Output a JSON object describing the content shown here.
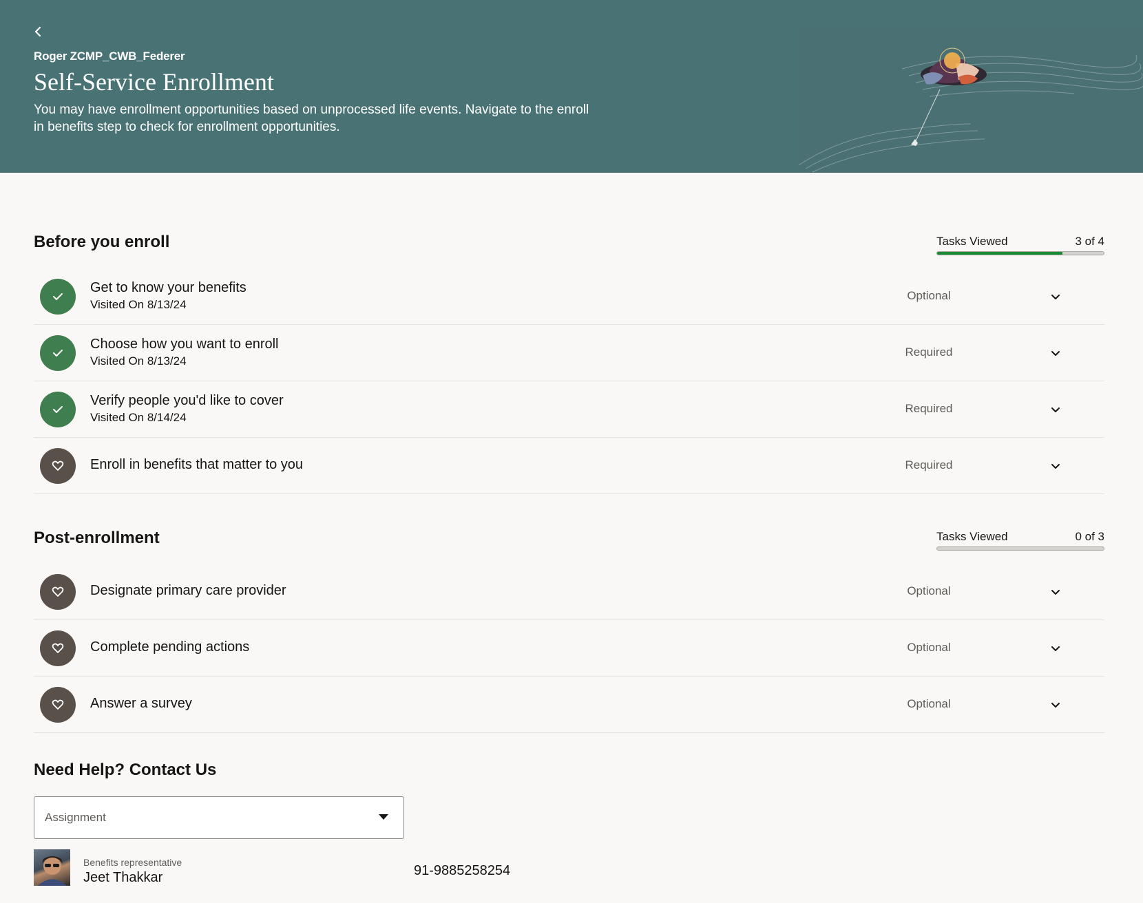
{
  "header": {
    "user_name": "Roger ZCMP_CWB_Federer",
    "title": "Self-Service Enrollment",
    "description": "You may have enrollment opportunities based on unprocessed life events. Navigate to the enroll in benefits step to check for enrollment opportunities."
  },
  "before_enroll": {
    "title": "Before you enroll",
    "progress_label": "Tasks Viewed",
    "progress_count": "3 of 4",
    "progress_fraction": 0.75,
    "tasks": [
      {
        "name": "Get to know your benefits",
        "visited": "Visited On 8/13/24",
        "status": "Optional",
        "done": true
      },
      {
        "name": "Choose how you want to enroll",
        "visited": "Visited On 8/13/24",
        "status": "Required",
        "done": true
      },
      {
        "name": "Verify people you'd like to cover",
        "visited": "Visited On 8/14/24",
        "status": "Required",
        "done": true
      },
      {
        "name": "Enroll in benefits that matter to you",
        "visited": "",
        "status": "Required",
        "done": false
      }
    ]
  },
  "post_enroll": {
    "title": "Post-enrollment",
    "progress_label": "Tasks Viewed",
    "progress_count": "0 of 3",
    "progress_fraction": 0,
    "tasks": [
      {
        "name": "Designate primary care provider",
        "visited": "",
        "status": "Optional",
        "done": false
      },
      {
        "name": "Complete pending actions",
        "visited": "",
        "status": "Optional",
        "done": false
      },
      {
        "name": "Answer a survey",
        "visited": "",
        "status": "Optional",
        "done": false
      }
    ]
  },
  "help": {
    "title": "Need Help? Contact Us",
    "select_value": "Assignment",
    "contact_role": "Benefits representative",
    "contact_name": "Jeet Thakkar",
    "contact_phone": "91-9885258254"
  },
  "colors": {
    "banner": "#487274",
    "done_circle": "#3f7e4e",
    "todo_circle": "#5a504a",
    "progress_fill": "#1c8a34"
  },
  "icons": {
    "back": "chevron-left-icon",
    "done": "check-icon",
    "todo": "heart-icon",
    "expand": "chevron-down-icon",
    "select": "caret-down-icon"
  }
}
